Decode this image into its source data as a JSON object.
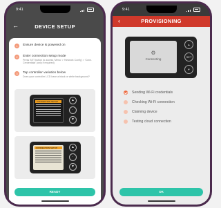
{
  "left_phone": {
    "time": "9:41",
    "header_title": "DEVICE SETUP",
    "back_icon": "arrow-left-icon",
    "steps": [
      {
        "num": "1",
        "title": "Ensure device is powered on",
        "desc": ""
      },
      {
        "num": "2",
        "title": "Enter connection setup mode",
        "desc": "Press SET button to access 'Menu' > 'Network Config' > 'Conn. Credentials' (only if required)"
      },
      {
        "num": "3",
        "title": "Tap controller variation below",
        "desc": "Does your controller LCD have a black or white background?"
      }
    ],
    "lcd_title": "CONNECTION SETUP",
    "ready_label": "READY"
  },
  "right_phone": {
    "time": "9:41",
    "header_title": "PROVISIONING",
    "back_icon": "chevron-left-icon",
    "screen_text": "Connecting",
    "device_buttons": [
      "▲",
      "SET",
      "▼"
    ],
    "status_items": [
      {
        "label": "Sending Wi-Fi credentials",
        "state": "done"
      },
      {
        "label": "Checking Wi-Fi connection",
        "state": "pending"
      },
      {
        "label": "Claiming device",
        "state": "pending"
      },
      {
        "label": "Testing cloud connection",
        "state": "pending"
      }
    ],
    "ok_label": "OK"
  },
  "colors": {
    "accent_red": "#d0392b",
    "accent_teal": "#2ec4a9",
    "step_orange": "#f39a7a",
    "phone_frame": "#4b2a4d"
  }
}
